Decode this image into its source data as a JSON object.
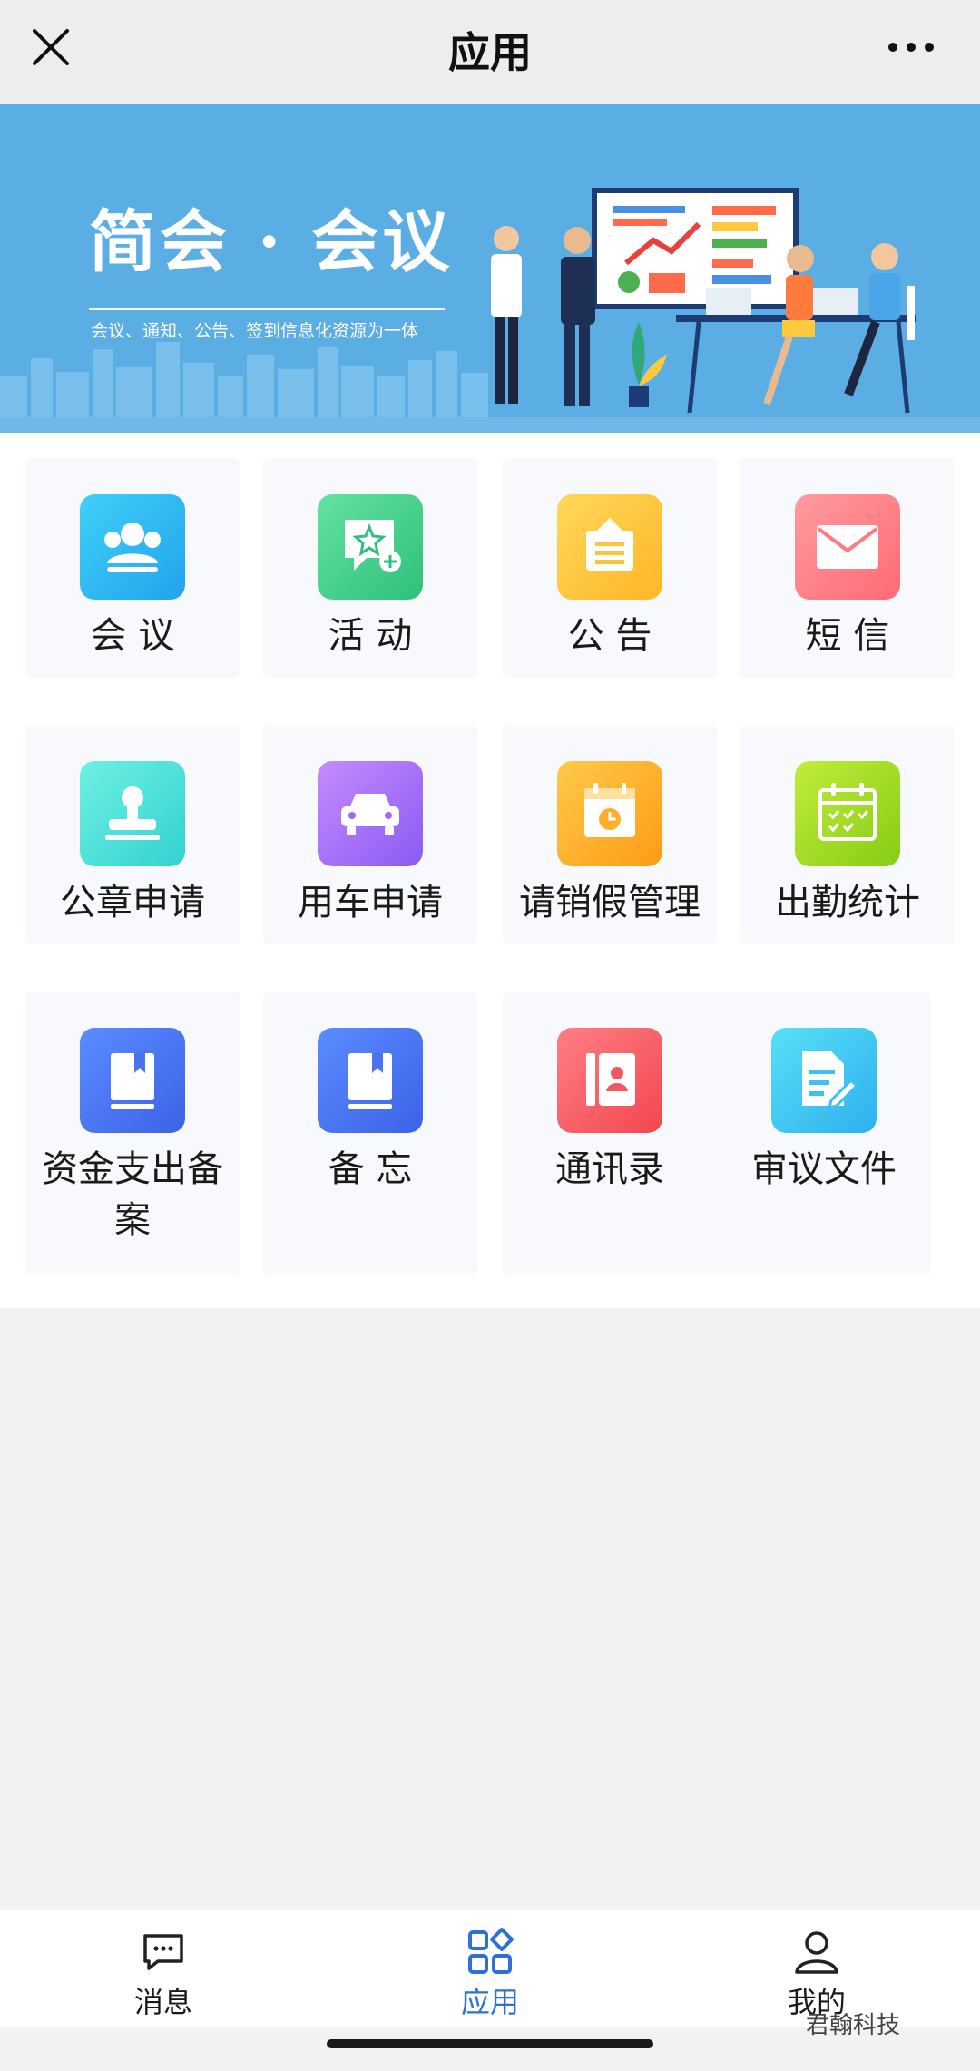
{
  "header": {
    "title": "应用",
    "close_icon": "close-icon",
    "more_icon": "more-icon"
  },
  "banner": {
    "title": "简会 · 会议",
    "subtitle": "会议、通知、公告、签到信息化资源为一体",
    "background": "#5baee3"
  },
  "apps": [
    {
      "label": "会 议",
      "icon": "meeting-group-icon",
      "color_from": "#3fd0f6",
      "color_to": "#22a3ee"
    },
    {
      "label": "活 动",
      "icon": "activity-star-icon",
      "color_from": "#64e2a0",
      "color_to": "#2fc07b"
    },
    {
      "label": "公 告",
      "icon": "notice-board-icon",
      "color_from": "#ffd85a",
      "color_to": "#ffb628"
    },
    {
      "label": "短 信",
      "icon": "envelope-icon",
      "color_from": "#ff9b9f",
      "color_to": "#ff6b75"
    },
    {
      "label": "公章申请",
      "icon": "seal-stamp-icon",
      "color_from": "#6df0e3",
      "color_to": "#33d2d1"
    },
    {
      "label": "用车申请",
      "icon": "car-icon",
      "color_from": "#c58bff",
      "color_to": "#8a5bf2"
    },
    {
      "label": "请销假管理",
      "icon": "calendar-clock-icon",
      "color_from": "#ffc94a",
      "color_to": "#ff9b16"
    },
    {
      "label": "出勤统计",
      "icon": "calendar-check-icon",
      "color_from": "#c2ec3c",
      "color_to": "#86cc15"
    },
    {
      "label": "资金支出备案",
      "icon": "book-bookmark-icon",
      "color_from": "#5a8cff",
      "color_to": "#3d62e8"
    },
    {
      "label": "备 忘",
      "icon": "memo-book-icon",
      "color_from": "#5a8cff",
      "color_to": "#3d62e8"
    },
    {
      "label": "通讯录",
      "icon": "contacts-book-icon",
      "color_from": "#ff7f84",
      "color_to": "#f2464f"
    },
    {
      "label": "审议文件",
      "icon": "document-edit-icon",
      "color_from": "#57e0f7",
      "color_to": "#2fb0ef"
    }
  ],
  "bottom_nav": {
    "items": [
      {
        "label": "消息",
        "icon": "chat-bubble-icon",
        "active": false
      },
      {
        "label": "应用",
        "icon": "apps-grid-icon",
        "active": true
      },
      {
        "label": "我的",
        "icon": "user-profile-icon",
        "active": false
      }
    ],
    "active_color": "#2f6fdd"
  },
  "watermark": "君翰科技"
}
